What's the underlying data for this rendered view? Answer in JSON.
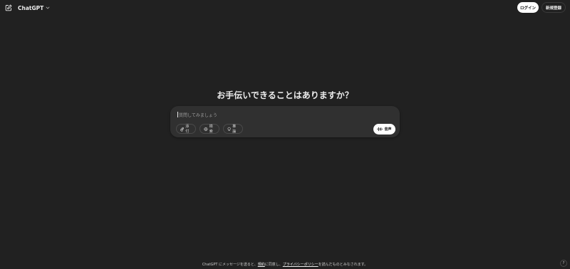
{
  "header": {
    "model_name": "ChatGPT",
    "login_label": "ログイン",
    "signup_label": "新規登録"
  },
  "main": {
    "headline": "お手伝いできることはありますか？",
    "composer": {
      "placeholder": "質問してみましょう",
      "tools": [
        {
          "label": "添付",
          "icon": "paperclip-icon"
        },
        {
          "label": "検索",
          "icon": "globe-icon"
        },
        {
          "label": "推論",
          "icon": "lightbulb-icon"
        }
      ],
      "voice_label": "音声",
      "voice_icon": "waveform-icon"
    }
  },
  "footer": {
    "text_before": "ChatGPT にメッセージを送ると、",
    "terms_link": "規約",
    "text_middle": "に同意し、",
    "privacy_link": "プライバシーポリシー",
    "text_after": "を読んだものとみなされます。",
    "help_label": "?"
  },
  "colors": {
    "background": "#212121",
    "composer": "#303030",
    "text": "#ececec",
    "button_light": "#ffffff"
  }
}
